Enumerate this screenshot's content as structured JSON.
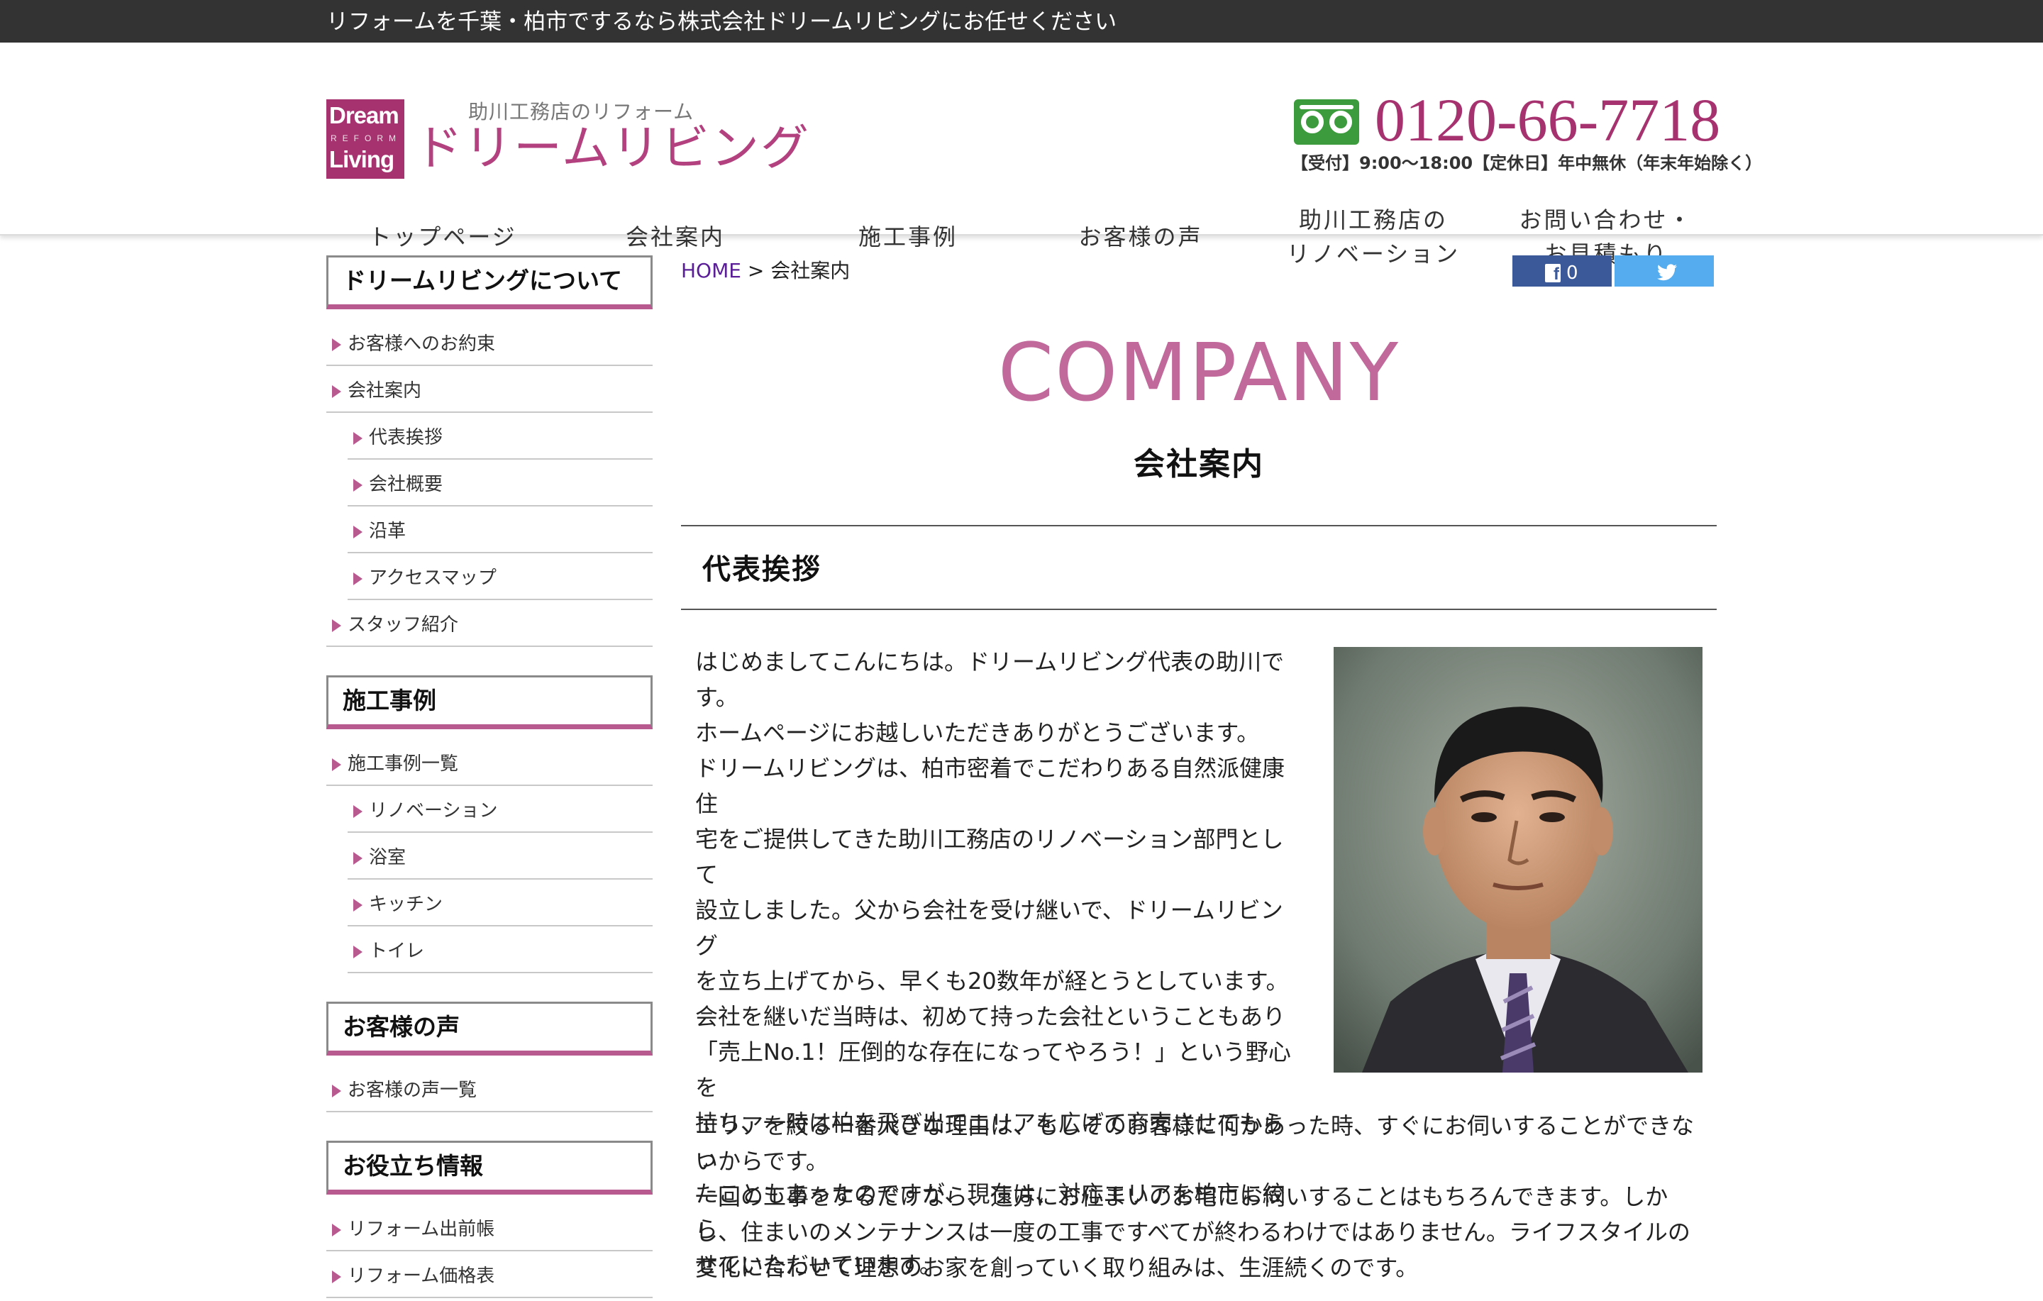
{
  "topbar": {
    "text": "リフォームを千葉・柏市でするなら株式会社ドリームリビングにお任せください"
  },
  "logo": {
    "box_line1": "Dream",
    "box_line2": "REFORM",
    "box_line3": "Living",
    "subtitle": "助川工務店のリフォーム",
    "name": "ドリームリビング"
  },
  "phone": {
    "number": "0120-66-7718",
    "hours": "【受付】9:00〜18:00【定休日】年中無休（年末年始除く）"
  },
  "nav": [
    {
      "label": "トップページ"
    },
    {
      "label": "会社案内"
    },
    {
      "label": "施工事例"
    },
    {
      "label": "お客様の声"
    },
    {
      "label": "助川工務店の\nリノベーション"
    },
    {
      "label": "お問い合わせ・\nお見積もり"
    }
  ],
  "sidebar": {
    "sections": [
      {
        "title": "ドリームリビングについて",
        "items": [
          {
            "label": "お客様へのお約束",
            "sub": false
          },
          {
            "label": "会社案内",
            "sub": false
          },
          {
            "label": "代表挨拶",
            "sub": true
          },
          {
            "label": "会社概要",
            "sub": true
          },
          {
            "label": "沿革",
            "sub": true
          },
          {
            "label": "アクセスマップ",
            "sub": true
          },
          {
            "label": "スタッフ紹介",
            "sub": false
          }
        ]
      },
      {
        "title": "施工事例",
        "items": [
          {
            "label": "施工事例一覧",
            "sub": false
          },
          {
            "label": "リノベーション",
            "sub": true
          },
          {
            "label": "浴室",
            "sub": true
          },
          {
            "label": "キッチン",
            "sub": true
          },
          {
            "label": "トイレ",
            "sub": true
          }
        ]
      },
      {
        "title": "お客様の声",
        "items": [
          {
            "label": "お客様の声一覧",
            "sub": false
          }
        ]
      },
      {
        "title": "お役立ち情報",
        "items": [
          {
            "label": "リフォーム出前帳",
            "sub": false
          },
          {
            "label": "リフォーム価格表",
            "sub": false
          }
        ]
      }
    ]
  },
  "breadcrumb": {
    "home": "HOME",
    "sep": " > ",
    "current": "会社案内"
  },
  "share": {
    "fb_count": "0"
  },
  "page": {
    "title": "COMPANY",
    "subtitle": "会社案内"
  },
  "section": {
    "heading": "代表挨拶",
    "para1": "はじめましてこんにちは。ドリームリビング代表の助川で\nす。\nホームページにお越しいただきありがとうございます。\nドリームリビングは、柏市密着でこだわりある自然派健康住\n宅をご提供してきた助川工務店のリノベーション部門として\n設立しました。父から会社を受け継いで、ドリームリビング\nを立ち上げてから、早くも20数年が経とうとしています。\n会社を継いだ当時は、初めて持った会社ということもあり\n「売上No.1！圧倒的な存在になってやろう！」という野心を\n持ち、一時は柏を飛び出てエリアを広げて商売させてもらっ\nたこともあったのですが、現在は、対応エリアを柏市に絞ら\nせていただいています。",
    "para2": "エリアを絞る一番大きな理由は、もしそのお客様に何かあった時、すぐにお伺いすることができな\nいからです。\n一回の工事をするだけなら、遠方にお住まいのお宅にお伺いすることはもちろんできます。しか\nし、住まいのメンテナンスは一度の工事ですべてが終わるわけではありません。ライフスタイルの\n変化に合わせて理想のお家を創っていく取り組みは、生涯続くのです。"
  },
  "colors": {
    "brand": "#a6326f",
    "accent": "#c0699a",
    "topbar": "#333333",
    "phone_icon": "#3c9b3c"
  }
}
